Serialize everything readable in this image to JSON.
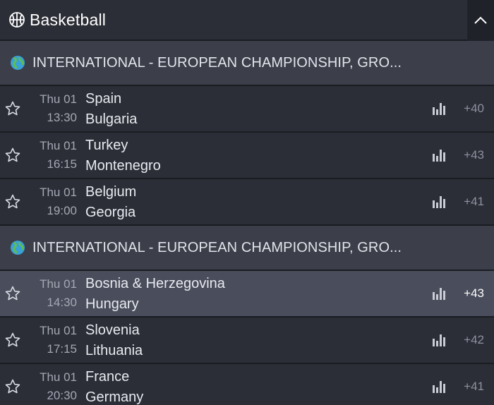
{
  "sport": {
    "title": "Basketball",
    "icon": "basketball-icon"
  },
  "groups": [
    {
      "league": "INTERNATIONAL   - EUROPEAN CHAMPIONSHIP, GRO...",
      "matches": [
        {
          "day": "Thu 01",
          "time": "13:30",
          "home": "Spain",
          "away": "Bulgaria",
          "more": "+40",
          "highlighted": false
        },
        {
          "day": "Thu 01",
          "time": "16:15",
          "home": "Turkey",
          "away": "Montenegro",
          "more": "+43",
          "highlighted": false
        },
        {
          "day": "Thu 01",
          "time": "19:00",
          "home": "Belgium",
          "away": "Georgia",
          "more": "+41",
          "highlighted": false
        }
      ]
    },
    {
      "league": "INTERNATIONAL   - EUROPEAN CHAMPIONSHIP, GRO...",
      "matches": [
        {
          "day": "Thu 01",
          "time": "14:30",
          "home": "Bosnia & Herzegovina",
          "away": "Hungary",
          "more": "+43",
          "highlighted": true
        },
        {
          "day": "Thu 01",
          "time": "17:15",
          "home": "Slovenia",
          "away": "Lithuania",
          "more": "+42",
          "highlighted": false
        },
        {
          "day": "Thu 01",
          "time": "20:30",
          "home": "France",
          "away": "Germany",
          "more": "+41",
          "highlighted": false
        }
      ]
    }
  ],
  "colors": {
    "background": "#23262e",
    "league_bar": "#3c3f4a",
    "row": "#2b2e36",
    "row_highlight": "#4a4d5b"
  }
}
